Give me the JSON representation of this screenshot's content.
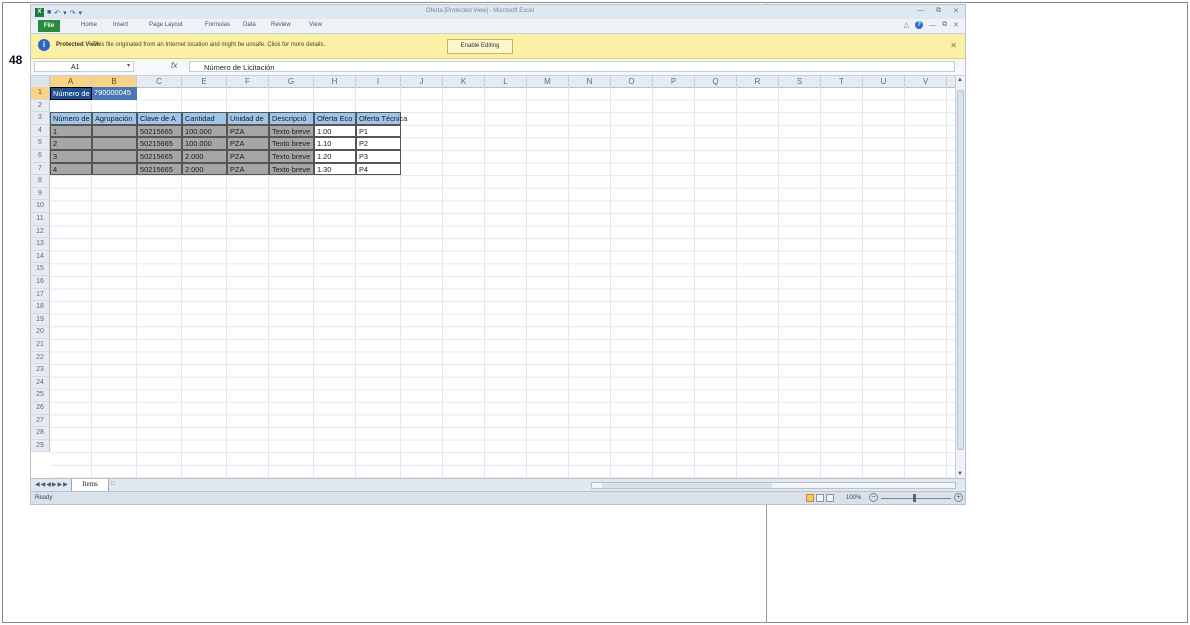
{
  "page_number": "48",
  "window": {
    "title": "Oferta [Protected View] - Microsoft Excel"
  },
  "ribbon": {
    "file": "File",
    "tabs": [
      "Home",
      "Insert",
      "Page Layout",
      "Formulas",
      "Data",
      "Review",
      "View"
    ]
  },
  "protected_view": {
    "title": "Protected View",
    "message": "This file originated from an Internet location and might be unsafe. Click for more details.",
    "button": "Enable Editing"
  },
  "formula_bar": {
    "name_box": "A1",
    "fx": "fx",
    "content": "Número de Licitación"
  },
  "columns": [
    "A",
    "B",
    "C",
    "E",
    "F",
    "G",
    "H",
    "I",
    "J",
    "K",
    "L",
    "M",
    "N",
    "O",
    "P",
    "Q",
    "R",
    "S",
    "T",
    "U",
    "V"
  ],
  "rows": [
    "1",
    "2",
    "3",
    "4",
    "5",
    "6",
    "7",
    "8",
    "9",
    "10",
    "11",
    "12",
    "13",
    "14",
    "15",
    "16",
    "17",
    "18",
    "19",
    "20",
    "21",
    "22",
    "23",
    "24",
    "25",
    "26",
    "27",
    "28",
    "29"
  ],
  "sheet": {
    "a1": "Número de",
    "b1": "790000045",
    "headers": [
      "Número de",
      "Agrupación",
      "Clave de A",
      "Cantidad",
      "Unidad de",
      "Descripció",
      "Oferta Eco",
      "Oferta Técnica"
    ],
    "data_rows": [
      [
        "1",
        "",
        "50215665",
        "100.000",
        "PZA",
        "Texto breve",
        "1.00",
        "P1"
      ],
      [
        "2",
        "",
        "50215665",
        "100.000",
        "PZA",
        "Texto breve",
        "1.10",
        "P2"
      ],
      [
        "3",
        "",
        "50215665",
        "2.000",
        "PZA",
        "Texto breve",
        "1.20",
        "P3"
      ],
      [
        "4",
        "",
        "50215665",
        "2.000",
        "PZA",
        "Texto breve",
        "1.30",
        "P4"
      ]
    ]
  },
  "sheet_tab": "Items",
  "status": {
    "text": "Ready",
    "zoom": "100%"
  }
}
